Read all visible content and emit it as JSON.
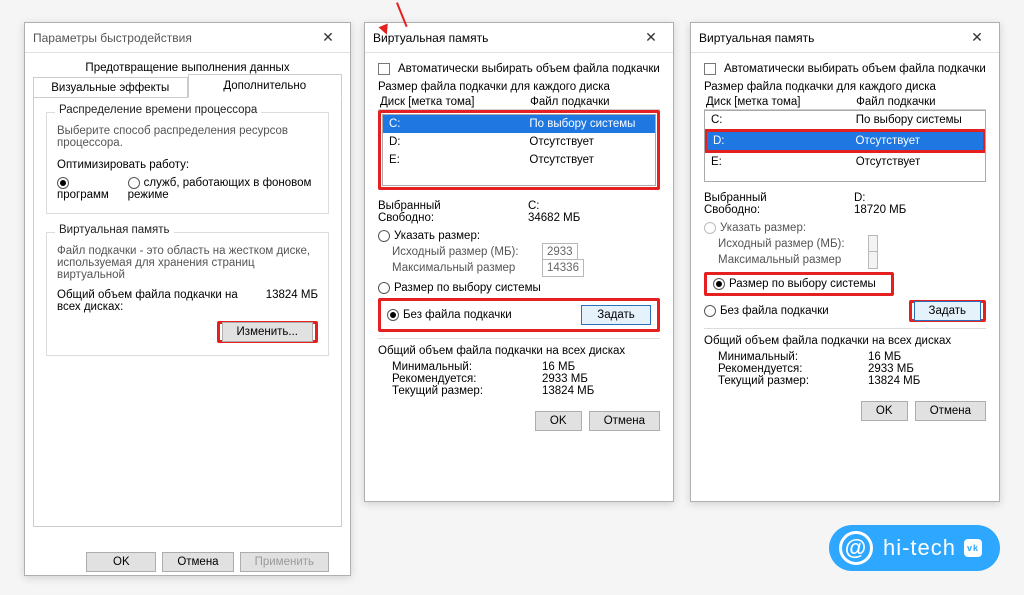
{
  "dlg1": {
    "title": "Параметры быстродействия",
    "tabs": {
      "visual": "Визуальные эффекты",
      "dep": "Предотвращение выполнения данных",
      "adv": "Дополнительно"
    },
    "cpu": {
      "group": "Распределение времени процессора",
      "desc": "Выберите способ распределения ресурсов процессора.",
      "optlabel": "Оптимизировать работу:",
      "programs": "программ",
      "services": "служб, работающих в фоновом режиме"
    },
    "vm": {
      "group": "Виртуальная память",
      "desc": "Файл подкачки - это область на жестком диске, используемая для хранения страниц виртуальной",
      "totallabel": "Общий объем файла подкачки на всех дисках:",
      "totalvalue": "13824 МБ",
      "change": "Изменить..."
    },
    "footer": {
      "ok": "OK",
      "cancel": "Отмена",
      "apply": "Применить"
    }
  },
  "dlg2": {
    "title": "Виртуальная память",
    "auto": "Автоматически выбирать объем файла подкачки",
    "perdrive": "Размер файла подкачки для каждого диска",
    "col_drive": "Диск [метка тома]",
    "col_pf": "Файл подкачки",
    "rows": [
      {
        "d": "C:",
        "v": "По выбору системы"
      },
      {
        "d": "D:",
        "v": "Отсутствует"
      },
      {
        "d": "E:",
        "v": "Отсутствует"
      }
    ],
    "selected_label": "Выбранный",
    "selected_value": "C:",
    "free_label": "Свободно:",
    "free_value": "34682 МБ",
    "specify": "Указать размер:",
    "init_label": "Исходный размер (МБ):",
    "init_value": "2933",
    "max_label": "Максимальный размер",
    "max_value": "14336",
    "sysmanaged": "Размер по выбору системы",
    "nopf": "Без файла подкачки",
    "set": "Задать",
    "totals_title": "Общий объем файла подкачки на всех дисках",
    "min_label": "Минимальный:",
    "min_value": "16 МБ",
    "rec_label": "Рекомендуется:",
    "rec_value": "2933 МБ",
    "cur_label": "Текущий размер:",
    "cur_value": "13824 МБ",
    "ok": "OK",
    "cancel": "Отмена"
  },
  "dlg3": {
    "title": "Виртуальная память",
    "auto": "Автоматически выбирать объем файла подкачки",
    "perdrive": "Размер файла подкачки для каждого диска",
    "col_drive": "Диск [метка тома]",
    "col_pf": "Файл подкачки",
    "rows": [
      {
        "d": "C:",
        "v": "По выбору системы"
      },
      {
        "d": "D:",
        "v": "Отсутствует"
      },
      {
        "d": "E:",
        "v": "Отсутствует"
      }
    ],
    "selected_label": "Выбранный",
    "selected_value": "D:",
    "free_label": "Свободно:",
    "free_value": "18720 МБ",
    "specify": "Указать размер:",
    "init_label": "Исходный размер (МБ):",
    "max_label": "Максимальный размер",
    "sysmanaged": "Размер по выбору системы",
    "nopf": "Без файла подкачки",
    "set": "Задать",
    "totals_title": "Общий объем файла подкачки на всех дисках",
    "min_label": "Минимальный:",
    "min_value": "16 МБ",
    "rec_label": "Рекомендуется:",
    "rec_value": "2933 МБ",
    "cur_label": "Текущий размер:",
    "cur_value": "13824 МБ",
    "ok": "OK",
    "cancel": "Отмена"
  },
  "logo": {
    "text": "hi-tech",
    "badge": "vk"
  }
}
